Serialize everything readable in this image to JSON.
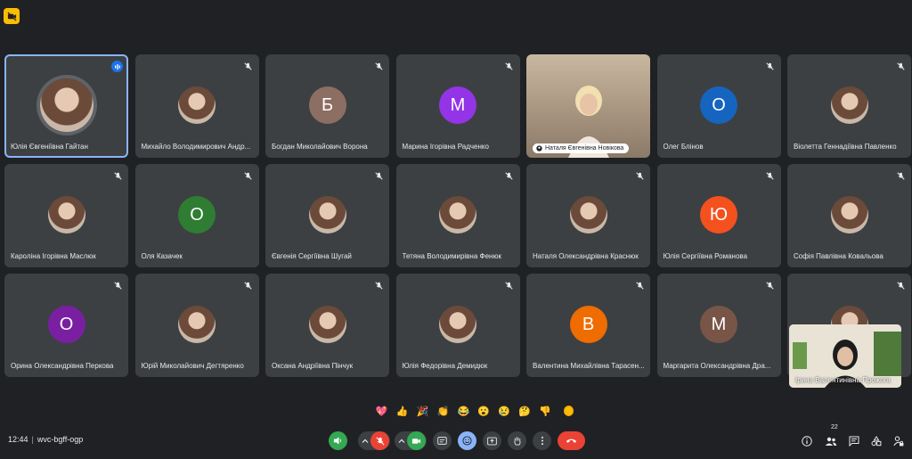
{
  "colors": {
    "accent": "#1a73e8",
    "tile": "#3c4043",
    "background": "#202124",
    "end_call": "#ea4335"
  },
  "tiles": [
    {
      "name": "Юлія Євгеніївна Гайтан",
      "kind": "photo-big",
      "status": "speaking"
    },
    {
      "name": "Михайло Володимирович Андр...",
      "kind": "photo",
      "status": "muted"
    },
    {
      "name": "Богдан Миколайович Ворона",
      "kind": "letter",
      "letter": "Б",
      "color": "#8d6e63",
      "status": "muted"
    },
    {
      "name": "Марина Ігорівна Радченко",
      "kind": "letter",
      "letter": "М",
      "color": "#9334e6",
      "status": "muted"
    },
    {
      "name": "Наталя Євгенівна Новікова",
      "kind": "video",
      "status": "none"
    },
    {
      "name": "Олег Блінов",
      "kind": "letter",
      "letter": "О",
      "color": "#1565c0",
      "status": "muted"
    },
    {
      "name": "Віолетта Геннадіївна Павленко",
      "kind": "photo",
      "status": "muted"
    },
    {
      "name": "Кароліна Ігорівна Маслюк",
      "kind": "photo",
      "status": "muted"
    },
    {
      "name": "Оля Казачек",
      "kind": "letter",
      "letter": "О",
      "color": "#2e7d32",
      "status": "muted"
    },
    {
      "name": "Євгенія Сергіївна Шугай",
      "kind": "photo",
      "status": "muted"
    },
    {
      "name": "Тетяна Володимирівна Фенюк",
      "kind": "photo",
      "status": "muted"
    },
    {
      "name": "Наталя Олександрівна Краснюк",
      "kind": "photo",
      "status": "muted"
    },
    {
      "name": "Юлія Сергіївна Романова",
      "kind": "letter",
      "letter": "Ю",
      "color": "#f4511e",
      "status": "muted"
    },
    {
      "name": "Софія Павлівна Ковальова",
      "kind": "photo",
      "status": "muted"
    },
    {
      "name": "Орина Олександрівна Перкова",
      "kind": "letter",
      "letter": "О",
      "color": "#7b1fa2",
      "status": "muted"
    },
    {
      "name": "Юрій Миколайович Дегтяренко",
      "kind": "photo",
      "status": "muted"
    },
    {
      "name": "Оксана Андріївна Пінчук",
      "kind": "photo",
      "status": "muted"
    },
    {
      "name": "Юлія Федорівна Демидюк",
      "kind": "photo",
      "status": "muted"
    },
    {
      "name": "Валентина Михайлівна Тарасен...",
      "kind": "letter",
      "letter": "В",
      "color": "#ef6c00",
      "status": "muted"
    },
    {
      "name": "Маргарита Олександрівна Дра...",
      "kind": "letter",
      "letter": "М",
      "color": "#795548",
      "status": "muted"
    },
    {
      "name": "",
      "kind": "photo",
      "status": "muted"
    }
  ],
  "self_view": {
    "name": "Ірина Валентинівна Прожога"
  },
  "reactions": [
    "💖",
    "👍",
    "🎉",
    "👏",
    "😂",
    "😮",
    "😢",
    "🤔",
    "👎"
  ],
  "bottom_bar": {
    "time": "12:44",
    "separator": "|",
    "meeting_code": "wvc-bgff-ogp",
    "participants_count": "22"
  }
}
